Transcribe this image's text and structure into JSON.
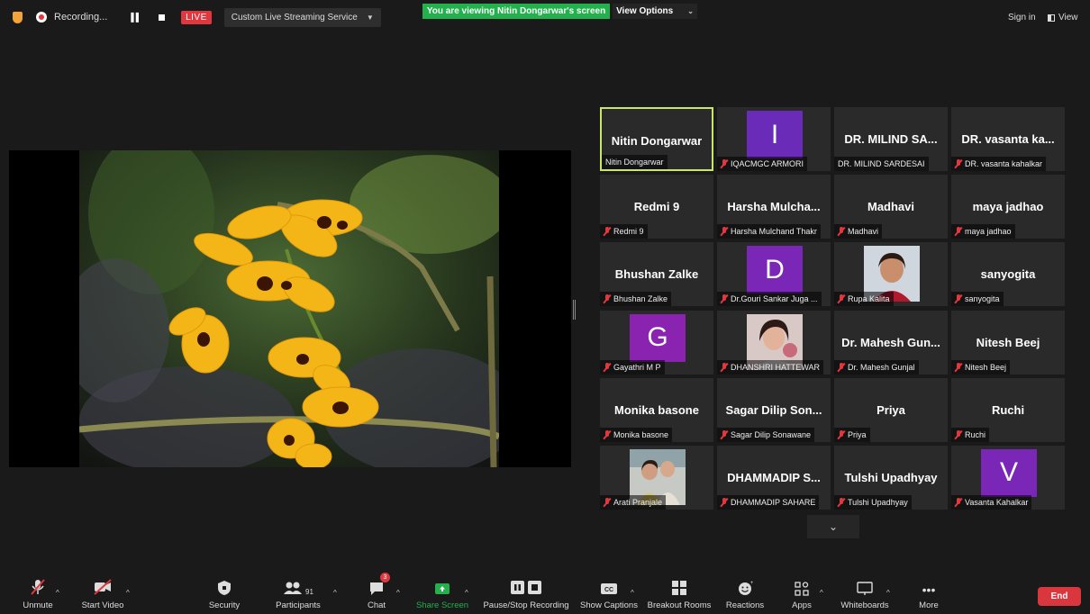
{
  "topbar": {
    "recording_label": "Recording...",
    "live_label": "LIVE",
    "stream_service": "Custom Live Streaming Service",
    "viewing_banner": "You are viewing Nitin Dongarwar's screen",
    "view_options": "View Options",
    "sign_in": "Sign in",
    "view": "View"
  },
  "gallery": {
    "tiles": [
      {
        "big": "Nitin Dongarwar",
        "tag": "Nitin Dongarwar",
        "muted": false,
        "active": true
      },
      {
        "letter": "I",
        "color": "#6a2bb8",
        "tag": "IQACMGC ARMORI",
        "muted": true
      },
      {
        "big": "DR. MILIND SA...",
        "tag": "DR. MILIND SARDESAI",
        "muted": false
      },
      {
        "big": "DR. vasanta ka...",
        "tag": "DR. vasanta kahalkar",
        "muted": true
      },
      {
        "big": "Redmi 9",
        "tag": "Redmi 9",
        "muted": true
      },
      {
        "big": "Harsha Mulcha...",
        "tag": "Harsha Mulchand Thakr",
        "muted": true
      },
      {
        "big": "Madhavi",
        "tag": "Madhavi",
        "muted": true
      },
      {
        "big": "maya jadhao",
        "tag": "maya jadhao",
        "muted": true
      },
      {
        "big": "Bhushan Zalke",
        "tag": "Bhushan Zalke",
        "muted": true
      },
      {
        "letter": "D",
        "color": "#7a27b8",
        "tag": "Dr.Gouri Sankar Juga ...",
        "muted": true
      },
      {
        "photo": "woman-portrait",
        "tag": "Rupa Kalita",
        "muted": true
      },
      {
        "big": "sanyogita",
        "tag": "sanyogita",
        "muted": true
      },
      {
        "letter": "G",
        "color": "#8a24b0",
        "tag": "Gayathri M P",
        "muted": true
      },
      {
        "photo": "girl-portrait",
        "tag": "DHANSHRI HATTEWAR",
        "muted": true
      },
      {
        "big": "Dr. Mahesh Gun...",
        "tag": "Dr. Mahesh Gunjal",
        "muted": true
      },
      {
        "big": "Nitesh Beej",
        "tag": "Nitesh Beej",
        "muted": true
      },
      {
        "big": "Monika basone",
        "tag": "Monika basone",
        "muted": true
      },
      {
        "big": "Sagar Dilip Son...",
        "tag": "Sagar Dilip Sonawane",
        "muted": true
      },
      {
        "big": "Priya",
        "tag": "Priya",
        "muted": true
      },
      {
        "big": "Ruchi",
        "tag": "Ruchi",
        "muted": true
      },
      {
        "photo": "family-portrait",
        "tag": "Arati Pranjale",
        "muted": true
      },
      {
        "big": "DHAMMADIP S...",
        "tag": "DHAMMADIP SAHARE",
        "muted": true
      },
      {
        "big": "Tulshi Upadhyay",
        "tag": "Tulshi Upadhyay",
        "muted": true
      },
      {
        "letter": "V",
        "color": "#7a27b8",
        "tag": "Vasanta Kahalkar",
        "muted": true
      }
    ]
  },
  "toolbar": {
    "unmute": "Unmute",
    "start_video": "Start Video",
    "security": "Security",
    "participants": "Participants",
    "participants_count": "91",
    "chat": "Chat",
    "chat_badge": "3",
    "share_screen": "Share Screen",
    "pause_stop_recording": "Pause/Stop Recording",
    "show_captions": "Show Captions",
    "breakout_rooms": "Breakout Rooms",
    "reactions": "Reactions",
    "apps": "Apps",
    "whiteboards": "Whiteboards",
    "more": "More",
    "end": "End"
  },
  "colors": {
    "live_red": "#e0383e",
    "banner_green": "#22b14c",
    "active_speaker": "#c8e66a",
    "end_red": "#d9373d"
  }
}
